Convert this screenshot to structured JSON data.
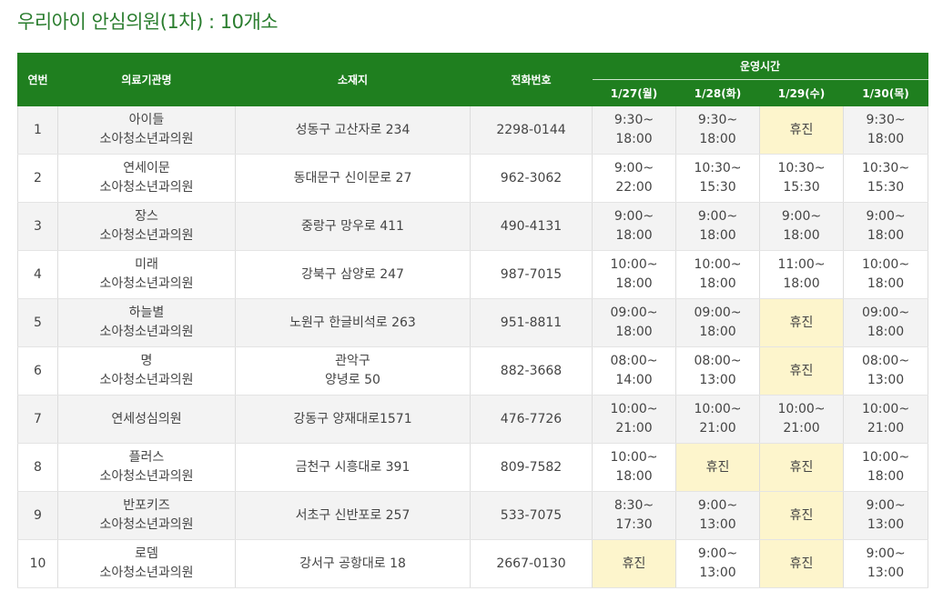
{
  "page": {
    "title": "우리아이 안심의원(1차) : 10개소"
  },
  "colors": {
    "title": "#2a7d2e",
    "header_bg": "#1f7f1f",
    "closed_bg": "#fdf5cc",
    "stripe_bg": "#f3f3f3"
  },
  "table": {
    "headers": {
      "no": "연번",
      "name": "의료기관명",
      "address": "소재지",
      "phone": "전화번호",
      "hours_group": "운영시간"
    },
    "days": [
      "1/27(월)",
      "1/28(화)",
      "1/29(수)",
      "1/30(목)"
    ],
    "closed_label": "휴진",
    "rows": [
      {
        "no": "1",
        "name": [
          "아이들",
          "소아청소년과의원"
        ],
        "address": [
          "성동구 고산자로 234"
        ],
        "phone": "2298-0144",
        "hours": [
          [
            "9:30~",
            "18:00"
          ],
          [
            "9:30~",
            "18:00"
          ],
          "closed",
          [
            "9:30~",
            "18:00"
          ]
        ]
      },
      {
        "no": "2",
        "name": [
          "연세이문",
          "소아청소년과의원"
        ],
        "address": [
          "동대문구 신이문로 27"
        ],
        "phone": "962-3062",
        "hours": [
          [
            "9:00~",
            "22:00"
          ],
          [
            "10:30~",
            "15:30"
          ],
          [
            "10:30~",
            "15:30"
          ],
          [
            "10:30~",
            "15:30"
          ]
        ]
      },
      {
        "no": "3",
        "name": [
          "장스",
          "소아청소년과의원"
        ],
        "address": [
          "중랑구 망우로 411"
        ],
        "phone": "490-4131",
        "hours": [
          [
            "9:00~",
            "18:00"
          ],
          [
            "9:00~",
            "18:00"
          ],
          [
            "9:00~",
            "18:00"
          ],
          [
            "9:00~",
            "18:00"
          ]
        ]
      },
      {
        "no": "4",
        "name": [
          "미래",
          "소아청소년과의원"
        ],
        "address": [
          "강북구 삼양로 247"
        ],
        "phone": "987-7015",
        "hours": [
          [
            "10:00~",
            "18:00"
          ],
          [
            "10:00~",
            "18:00"
          ],
          [
            "11:00~",
            "18:00"
          ],
          [
            "10:00~",
            "18:00"
          ]
        ]
      },
      {
        "no": "5",
        "name": [
          "하늘별",
          "소아청소년과의원"
        ],
        "address": [
          "노원구 한글비석로 263"
        ],
        "phone": "951-8811",
        "hours": [
          [
            "09:00~",
            "18:00"
          ],
          [
            "09:00~",
            "18:00"
          ],
          "closed",
          [
            "09:00~",
            "18:00"
          ]
        ]
      },
      {
        "no": "6",
        "name": [
          "명",
          "소아청소년과의원"
        ],
        "address": [
          "관악구",
          "양녕로 50"
        ],
        "phone": "882-3668",
        "hours": [
          [
            "08:00~",
            "14:00"
          ],
          [
            "08:00~",
            "13:00"
          ],
          "closed",
          [
            "08:00~",
            "13:00"
          ]
        ]
      },
      {
        "no": "7",
        "name": [
          "연세성심의원"
        ],
        "address": [
          "강동구 양재대로1571"
        ],
        "phone": "476-7726",
        "hours": [
          [
            "10:00~",
            "21:00"
          ],
          [
            "10:00~",
            "21:00"
          ],
          [
            "10:00~",
            "21:00"
          ],
          [
            "10:00~",
            "21:00"
          ]
        ]
      },
      {
        "no": "8",
        "name": [
          "플러스",
          "소아청소년과의원"
        ],
        "address": [
          "금천구 시흥대로 391"
        ],
        "phone": "809-7582",
        "hours": [
          [
            "10:00~",
            "18:00"
          ],
          "closed",
          "closed",
          [
            "10:00~",
            "18:00"
          ]
        ]
      },
      {
        "no": "9",
        "name": [
          "반포키즈",
          "소아청소년과의원"
        ],
        "address": [
          "서초구 신반포로 257"
        ],
        "phone": "533-7075",
        "hours": [
          [
            "8:30~",
            "17:30"
          ],
          [
            "9:00~",
            "13:00"
          ],
          "closed",
          [
            "9:00~",
            "13:00"
          ]
        ]
      },
      {
        "no": "10",
        "name": [
          "로뎀",
          "소아청소년과의원"
        ],
        "address": [
          "강서구 공항대로 18"
        ],
        "phone": "2667-0130",
        "hours": [
          "closed",
          [
            "9:00~",
            "13:00"
          ],
          "closed",
          [
            "9:00~",
            "13:00"
          ]
        ]
      }
    ]
  }
}
